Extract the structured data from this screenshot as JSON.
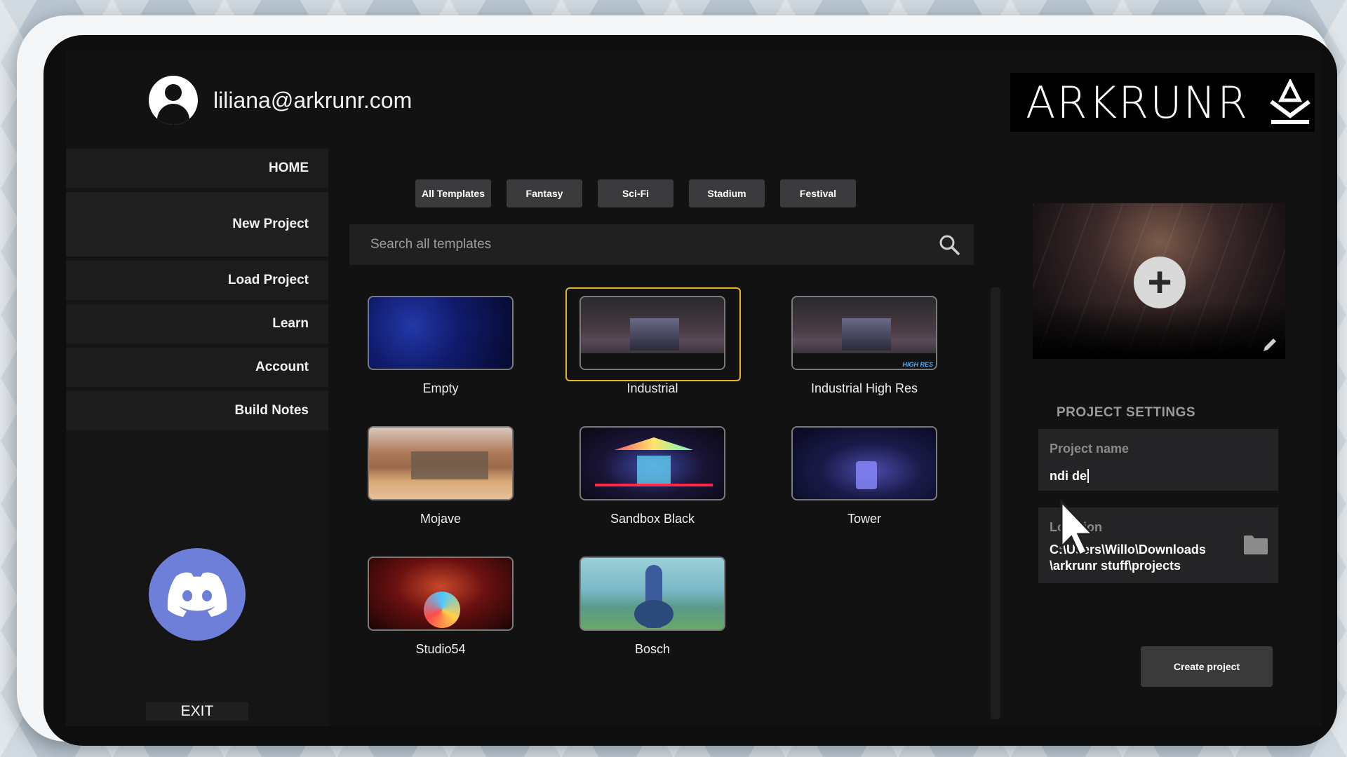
{
  "user": {
    "email": "liliana@arkrunr.com",
    "avatar_icon": "user-circle-icon"
  },
  "brand": {
    "logo_text": "ARKRUNR"
  },
  "sidebar": {
    "items": [
      {
        "label": "HOME"
      },
      {
        "label": "New Project"
      },
      {
        "label": "Load Project"
      },
      {
        "label": "Learn"
      },
      {
        "label": "Account"
      },
      {
        "label": "Build Notes"
      }
    ],
    "discord_icon": "discord-icon",
    "exit_label": "EXIT"
  },
  "filters": {
    "tabs": [
      {
        "label": "All Templates"
      },
      {
        "label": "Fantasy"
      },
      {
        "label": "Sci-Fi"
      },
      {
        "label": "Stadium"
      },
      {
        "label": "Festival"
      }
    ]
  },
  "search": {
    "placeholder": "Search all templates",
    "icon": "search-icon"
  },
  "templates": [
    {
      "label": "Empty"
    },
    {
      "label": "Industrial",
      "selected": true
    },
    {
      "label": "Industrial High Res",
      "badge": "HIGH RES"
    },
    {
      "label": "Mojave"
    },
    {
      "label": "Sandbox Black"
    },
    {
      "label": "Tower"
    },
    {
      "label": "Studio54"
    },
    {
      "label": "Bosch"
    }
  ],
  "project_settings": {
    "title": "PROJECT SETTINGS",
    "name_label": "Project name",
    "name_value": "ndi de",
    "location_label": "Location",
    "location_value_line1": "C:\\Users\\Willo\\Downloads",
    "location_value_line2": "\\arkrunr stuff\\projects",
    "create_label": "Create project"
  },
  "colors": {
    "accent_selected": "#e3b423",
    "discord": "#6e7fd9"
  }
}
